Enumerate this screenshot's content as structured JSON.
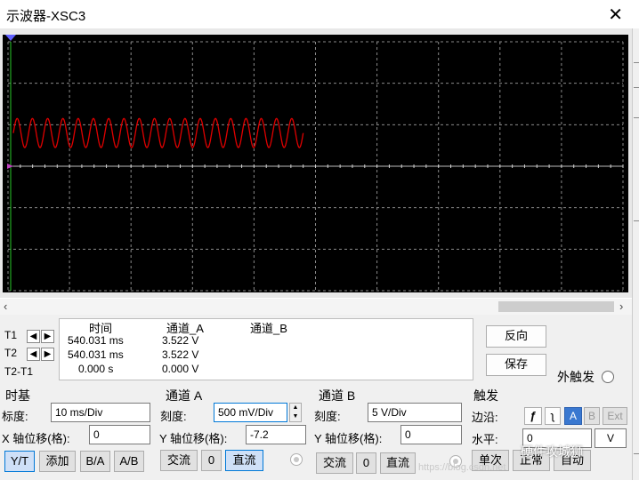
{
  "window": {
    "title": "示波器-XSC3",
    "close_icon": "close-icon"
  },
  "scope": {
    "background": "#000000",
    "grid_color": "#8a8a8a",
    "trace_color": "#e00000",
    "divisions_x": 10,
    "divisions_y": 6
  },
  "chart_data": {
    "type": "line",
    "title": "",
    "xlabel": "",
    "ylabel": "",
    "series": [
      {
        "name": "",
        "waveform": "sine",
        "cycles_visible": 19,
        "x_range_div": [
          0,
          4.8
        ],
        "amplitude_div": 0.35,
        "center_div": 0.8
      }
    ],
    "xlim_div": [
      0,
      10
    ],
    "ylim_div": [
      -3,
      3
    ],
    "grid": true
  },
  "cursors": {
    "t1_label": "T1",
    "t2_label": "T2",
    "diff_label": "T2-T1",
    "left_arrow_icon": "arrow-left-icon",
    "right_arrow_icon": "arrow-right-icon"
  },
  "readout": {
    "col_time": "时间",
    "col_a": "通道_A",
    "col_b": "通道_B",
    "t1_time": "540.031 ms",
    "t1_a": "3.522 V",
    "t2_time": "540.031 ms",
    "t2_a": "3.522 V",
    "diff_time": "0.000 s",
    "diff_a": "0.000 V"
  },
  "actions": {
    "reverse": "反向",
    "save": "保存",
    "ext_trigger": "外触发"
  },
  "timebase": {
    "group": "时基",
    "scale_label": "标度:",
    "scale_value": "10 ms/Div",
    "xpos_label": "X 轴位移(格):",
    "xpos_value": "0",
    "modes": [
      "Y/T",
      "添加",
      "B/A",
      "A/B"
    ]
  },
  "channel_a": {
    "group": "通道 A",
    "scale_label": "刻度:",
    "scale_value": "500 mV/Div",
    "ypos_label": "Y 轴位移(格):",
    "ypos_value": "-7.2",
    "coupling": [
      "交流",
      "0",
      "直流"
    ]
  },
  "channel_b": {
    "group": "通道 B",
    "scale_label": "刻度:",
    "scale_value": "5 V/Div",
    "ypos_label": "Y 轴位移(格):",
    "ypos_value": "0",
    "coupling": [
      "交流",
      "0",
      "直流"
    ]
  },
  "trigger": {
    "group": "触发",
    "edge_label": "边沿:",
    "edge_buttons": [
      "A",
      "B",
      "Ext"
    ],
    "level_label": "水平:",
    "level_value": "0",
    "level_unit": "V",
    "modes": [
      "单次",
      "正常",
      "自动"
    ]
  },
  "watermark": {
    "text": "硬件攻城狮",
    "url_text": "https://blog.csdn.net"
  }
}
